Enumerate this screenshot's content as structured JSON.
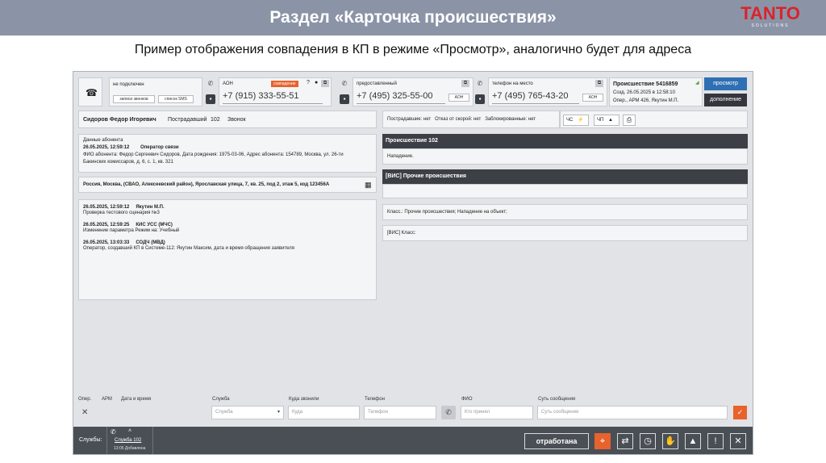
{
  "slide": {
    "title": "Раздел «Карточка происшествия»",
    "subtitle": "Пример отображения совпадения в КП в режиме «Просмотр», аналогично будет для адреса",
    "logo": {
      "main": "TANTO",
      "sub": "SOLUTIONS"
    }
  },
  "top": {
    "status": "не подключен",
    "calls_button": "записи звонков",
    "sms_button": "список SMS",
    "aon": {
      "label": "АОН",
      "badge": "совпадение",
      "number": "+7 (915) 333-55-51"
    },
    "provided": {
      "label": "предоставленный",
      "number": "+7 (495) 325-55-00",
      "button": "АОН"
    },
    "on_site": {
      "label": "телефон на место",
      "number": "+7 (495) 765-43-20",
      "button": "АОН"
    },
    "incident": {
      "title": "Происшествие 5416859",
      "created": "Созд. 26.05.2025 в 12:58:10",
      "operator": "Опер., АРМ 426, Якутин М.П."
    },
    "view_button": "просмотр",
    "more_button": "дополнение"
  },
  "caller": {
    "name": "Сидоров Федор Игоревич",
    "role": "Пострадавший",
    "count": "102",
    "type": "Звонок"
  },
  "subscriber": {
    "heading": "Данные абонента",
    "timestamp": "26.05.2025, 12:59:12",
    "author": "Оператор связи",
    "line1": "ФИО абонента: Федор Сергеевич Сидоров, Дата рождения: 1975-03-06, Адрес абонента: 154789, Москва, ул. 26-ти",
    "line2": "Бакинских комиссаров, д. 6, с. 1, кв. 321"
  },
  "address": "Россия, Москва, (СВАО, Алексеевский район), Ярославская улица, 7, кв. 25, под 2, этаж 5, код 123456А",
  "log": [
    {
      "time": "26.05.2025, 12:59:12",
      "who": "Якутин М.П.",
      "text": "Проверка тестового сценария №3"
    },
    {
      "time": "26.05.2025, 12:59:25",
      "who": "КИС УСС (МЧС)",
      "text": "Изменение параметра Режим на: Учебный"
    },
    {
      "time": "26.05.2025, 13:03:33",
      "who": "СОДЧ (МВД)",
      "text": "Оператор, создавший КП в Системе-112: Якутин Максим, дата и время обращения заявителя"
    }
  ],
  "right": {
    "status": "Пострадавшие: нет   Отказ от скорой: нет   Заблокированные: нет",
    "chs": "ЧС",
    "chp": "ЧП",
    "incident_header": "Происшествие 102",
    "incident_text": "Нападение.",
    "vis_header": "[ВИС] Прочие происшествия",
    "class_text": "Класс.: Прочие происшествия; Нападение на объект;",
    "vis_class": "[ВИС] Класс:"
  },
  "form": {
    "col_oper": "Опер.",
    "col_arm": "АРМ",
    "col_datetime": "Дата и время",
    "service_label": "Служба",
    "service_placeholder": "Служба",
    "where_label": "Куда звонили",
    "where_placeholder": "Куда",
    "phone_label": "Телефон",
    "phone_placeholder": "Телефон",
    "fio_label": "ФИО",
    "fio_placeholder": "Кто принял",
    "message_label": "Суть сообщения",
    "message_placeholder": "Суть сообщения"
  },
  "bottom": {
    "services_label": "Службы:",
    "service_tab": "Служба 102",
    "service_status": "13:05 Добавлена",
    "done_button": "отработана"
  },
  "colors": {
    "banner": "#8a94a6",
    "accent_blue": "#2f6fb3",
    "alert": "#e8622c",
    "logo_red": "#d9232d"
  }
}
